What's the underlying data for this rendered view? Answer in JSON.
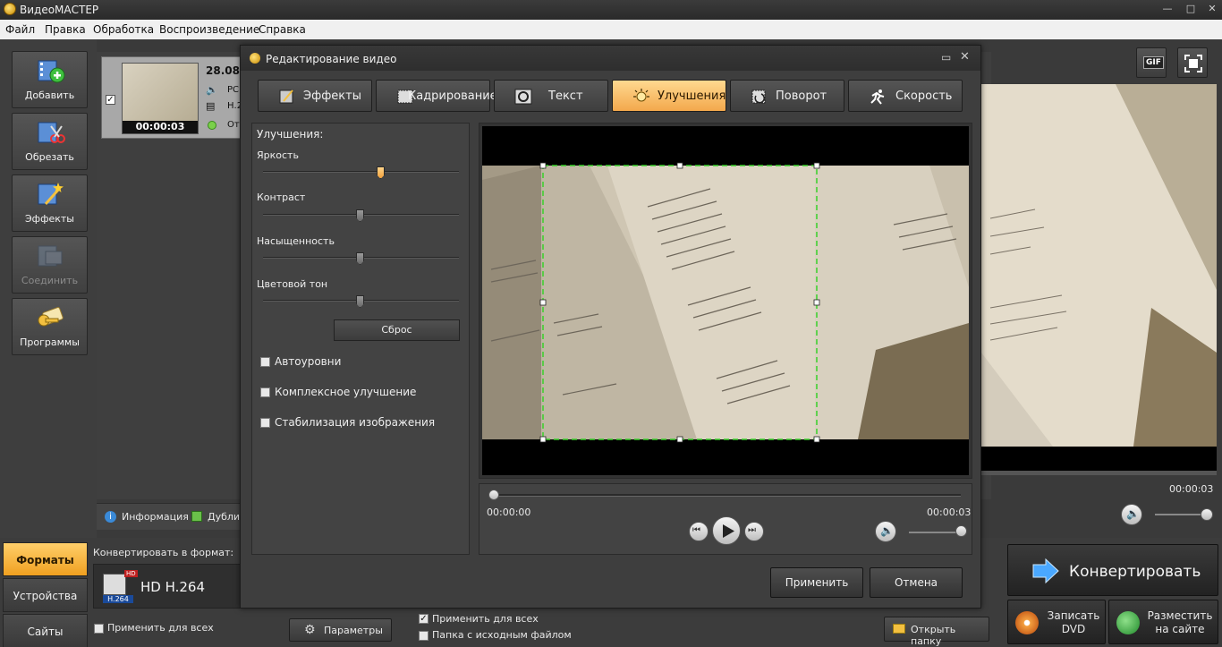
{
  "app": {
    "title": "ВидеоМАСТЕР"
  },
  "menu": [
    "Файл",
    "Правка",
    "Обработка",
    "Воспроизведение",
    "Справка"
  ],
  "sidebar": {
    "items": [
      {
        "label": "Добавить",
        "icon": "add-video-icon"
      },
      {
        "label": "Обрезать",
        "icon": "scissors-icon"
      },
      {
        "label": "Эффекты",
        "icon": "magic-wand-icon"
      },
      {
        "label": "Соединить",
        "icon": "join-icon",
        "disabled": true
      },
      {
        "label": "Программы",
        "icon": "programs-icon"
      }
    ]
  },
  "file": {
    "date": "28.08.",
    "audio": "РС",
    "codec": "Н.2",
    "status": "От",
    "duration": "00:00:03"
  },
  "info_tabs": {
    "info": "Информация",
    "dub": "Дублир"
  },
  "bottom": {
    "tabs": [
      "Форматы",
      "Устройства",
      "Сайты"
    ],
    "convert_label": "Конвертировать в формат:",
    "format_badge_hd": "HD",
    "format_badge_codec": "H.264",
    "format_name": "HD H.264",
    "apply_all": "Применить для всех",
    "params_btn": "Параметры",
    "apply_all2": "Применить для всех",
    "source_folder": "Папка с исходным файлом",
    "open_folder": "Открыть папку",
    "convert_btn": "Конвертировать",
    "burn_dvd": "Записать DVD",
    "publish": "Разместить на сайте"
  },
  "right_panel": {
    "time": "00:00:03",
    "gif": "GIF"
  },
  "dialog": {
    "title": "Редактирование видео",
    "tabs": [
      "Эффекты",
      "Кадрирование",
      "Текст",
      "Улучшения",
      "Поворот",
      "Скорость"
    ],
    "active_tab": "Улучшения",
    "section": "Улучшения:",
    "sliders": [
      {
        "label": "Яркость",
        "value": 0.6
      },
      {
        "label": "Контраст",
        "value": 0.5
      },
      {
        "label": "Насыщенность",
        "value": 0.5
      },
      {
        "label": "Цветовой тон",
        "value": 0.5
      }
    ],
    "reset": "Сброс",
    "checkboxes": [
      "Автоуровни",
      "Комплексное улучшение",
      "Стабилизация изображения"
    ],
    "time_start": "00:00:00",
    "time_end": "00:00:03",
    "apply": "Применить",
    "cancel": "Отмена"
  },
  "colors": {
    "accent": "#f3a84c",
    "crop": "#39d12a"
  }
}
